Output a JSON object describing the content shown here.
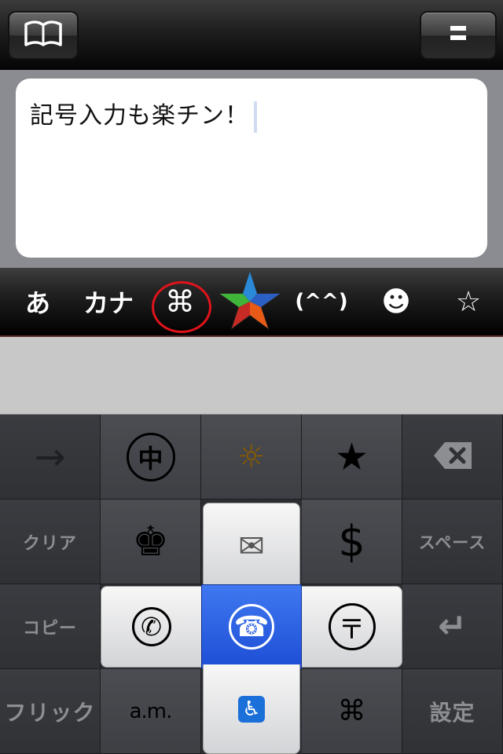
{
  "top_bar": {
    "left_button_icon": "book-icon",
    "right_button_icon": "menu-icon"
  },
  "editor": {
    "text": "記号入力も楽チン！"
  },
  "mode_bar": {
    "items": [
      {
        "label": "あ"
      },
      {
        "label": "カナ"
      },
      {
        "label": "⌘"
      },
      {
        "icon": "colorful-star-icon"
      },
      {
        "label": "(^^)"
      },
      {
        "label": "☻"
      },
      {
        "label": "☆"
      }
    ],
    "highlight_color": "#e0131b"
  },
  "keyboard": {
    "row1": [
      {
        "label": "→"
      },
      {
        "label": "中"
      },
      {
        "label": "☼"
      },
      {
        "label": "★"
      },
      {
        "icon": "backspace-icon"
      }
    ],
    "row2": [
      {
        "label": "クリア"
      },
      {
        "label": "♚"
      },
      {
        "label": "✉"
      },
      {
        "label": "$"
      },
      {
        "label": "スペース"
      }
    ],
    "row3": [
      {
        "label": "コピー"
      },
      {
        "label": "✆"
      },
      {
        "label": "☎"
      },
      {
        "label": "〒"
      },
      {
        "label": "↵"
      }
    ],
    "row4": [
      {
        "label": "フリック"
      },
      {
        "label": "a.m."
      },
      {
        "label": "♿"
      },
      {
        "label": "⌘"
      },
      {
        "label": "設定"
      }
    ],
    "active_color": "#1d4ed6"
  }
}
